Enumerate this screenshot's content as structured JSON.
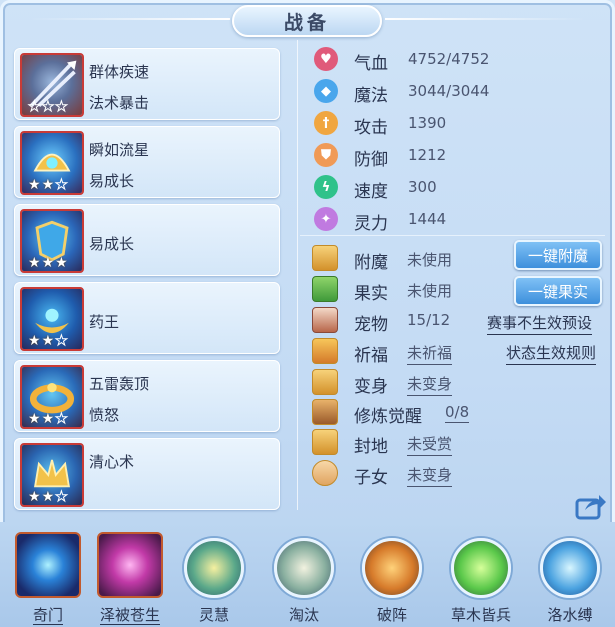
{
  "title": "战备",
  "colors": {
    "accent": "#3d8fdc",
    "skill_border": "#c93b37",
    "panel": "#d3e6f8"
  },
  "skills": [
    {
      "line1": "群体疾速",
      "line2": "法术暴击",
      "stars": 0,
      "icon": "lance-icon"
    },
    {
      "line1": "瞬如流星",
      "line2": "易成长",
      "stars": 2,
      "icon": "helmet-icon"
    },
    {
      "line1": "",
      "line2": "易成长",
      "stars": 3,
      "icon": "armor-icon"
    },
    {
      "line1": "",
      "line2": "药王",
      "stars": 2,
      "icon": "crescent-icon"
    },
    {
      "line1": "五雷轰顶",
      "line2": "愤怒",
      "stars": 2,
      "icon": "ring-icon"
    },
    {
      "line1": "清心术",
      "line2": "",
      "stars": 2,
      "icon": "crown-icon"
    }
  ],
  "stats": [
    {
      "label": "气血",
      "value": "4752/4752",
      "color": "#e05a7a",
      "icon": "heart-icon"
    },
    {
      "label": "魔法",
      "value": "3044/3044",
      "color": "#49a6ec",
      "icon": "diamond-icon"
    },
    {
      "label": "攻击",
      "value": "1390",
      "color": "#f0a640",
      "icon": "sword-icon"
    },
    {
      "label": "防御",
      "value": "1212",
      "color": "#f09a56",
      "icon": "shield-icon"
    },
    {
      "label": "速度",
      "value": "300",
      "color": "#2fc28a",
      "icon": "lightning-icon"
    },
    {
      "label": "灵力",
      "value": "1444",
      "color": "#c07ae0",
      "icon": "sparkle-icon"
    }
  ],
  "info": [
    {
      "label": "附魔",
      "value": "未使用",
      "underline": false,
      "icon": "enchant-icon"
    },
    {
      "label": "果实",
      "value": "未使用",
      "underline": false,
      "icon": "fruit-icon"
    },
    {
      "label": "宠物",
      "value": "15/12",
      "underline": false,
      "icon": "pet-icon"
    },
    {
      "label": "祈福",
      "value": "未祈福",
      "underline": true,
      "icon": "blessing-icon"
    },
    {
      "label": "变身",
      "value": "未变身",
      "underline": true,
      "icon": "transform-icon"
    },
    {
      "label": "修炼觉醒",
      "value": "0/8",
      "underline": true,
      "icon": "cultivation-icon"
    },
    {
      "label": "封地",
      "value": "未受赏",
      "underline": true,
      "icon": "fief-icon"
    },
    {
      "label": "子女",
      "value": "未变身",
      "underline": true,
      "icon": "child-icon"
    }
  ],
  "buttons": {
    "enchant": "一键附魔",
    "fruit": "一键果实"
  },
  "links": {
    "event": "赛事不生效预设",
    "status": "状态生效规则"
  },
  "formations": [
    {
      "label": "奇门",
      "underline": true
    },
    {
      "label": "泽被苍生",
      "underline": true
    },
    {
      "label": "灵慧",
      "underline": false
    },
    {
      "label": "淘汰",
      "underline": false
    },
    {
      "label": "破阵",
      "underline": false
    },
    {
      "label": "草木皆兵",
      "underline": false
    },
    {
      "label": "洛水缚",
      "underline": false
    }
  ]
}
